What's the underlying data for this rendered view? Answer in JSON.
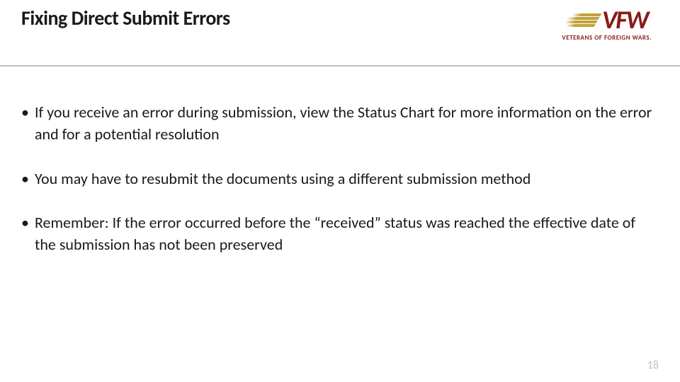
{
  "header": {
    "title": "Fixing Direct Submit Errors",
    "logo": {
      "acronym": "VFW",
      "subtitle": "VETERANS OF FOREIGN WARS."
    }
  },
  "bullets": {
    "item1": "If you receive an error during submission, view the Status Chart for more information on the error and for a potential resolution",
    "item2": "You may have to resubmit the documents using a different submission method",
    "item3": "Remember: If the error occurred before the “received” status was reached the effective date of the submission has not been preserved"
  },
  "footer": {
    "page_number": "18"
  }
}
